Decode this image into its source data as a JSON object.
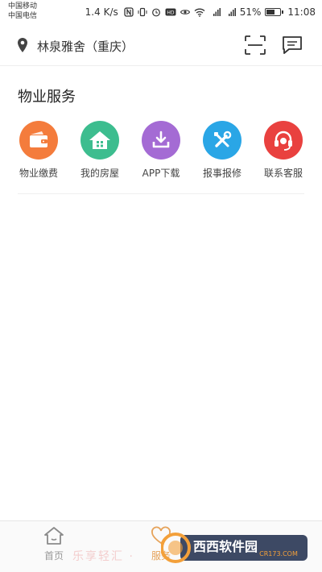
{
  "status_bar": {
    "carrier_1": "中国移动",
    "carrier_2": "中国电信",
    "net_speed": "1.4 K/s",
    "battery": "51%",
    "battery_level": 0.51,
    "time": "11:08"
  },
  "header": {
    "location": "林泉雅舍（重庆）",
    "location_icon": "location-pin-icon",
    "scan_icon": "scan-icon",
    "message_icon": "message-icon"
  },
  "section": {
    "title": "物业服务",
    "services": [
      {
        "label": "物业缴费",
        "icon": "wallet-icon",
        "color": "#f47c3c"
      },
      {
        "label": "我的房屋",
        "icon": "house-icon",
        "color": "#3dbd8f"
      },
      {
        "label": "APP下载",
        "icon": "download-icon",
        "color": "#a46bd4"
      },
      {
        "label": "报事报修",
        "icon": "tools-icon",
        "color": "#2aa6e6"
      },
      {
        "label": "联系客服",
        "icon": "headset-icon",
        "color": "#e9413f"
      }
    ]
  },
  "bottom_nav": {
    "items": [
      {
        "label": "首页",
        "icon": "home-icon"
      },
      {
        "label": "服务",
        "icon": "heart-hands-icon"
      }
    ],
    "active_color": "#e6a35a",
    "inactive_color": "#999999"
  },
  "watermark": {
    "text": "乐享轻汇 ·",
    "brand": "西西软件园",
    "url": "CR173.COM"
  }
}
